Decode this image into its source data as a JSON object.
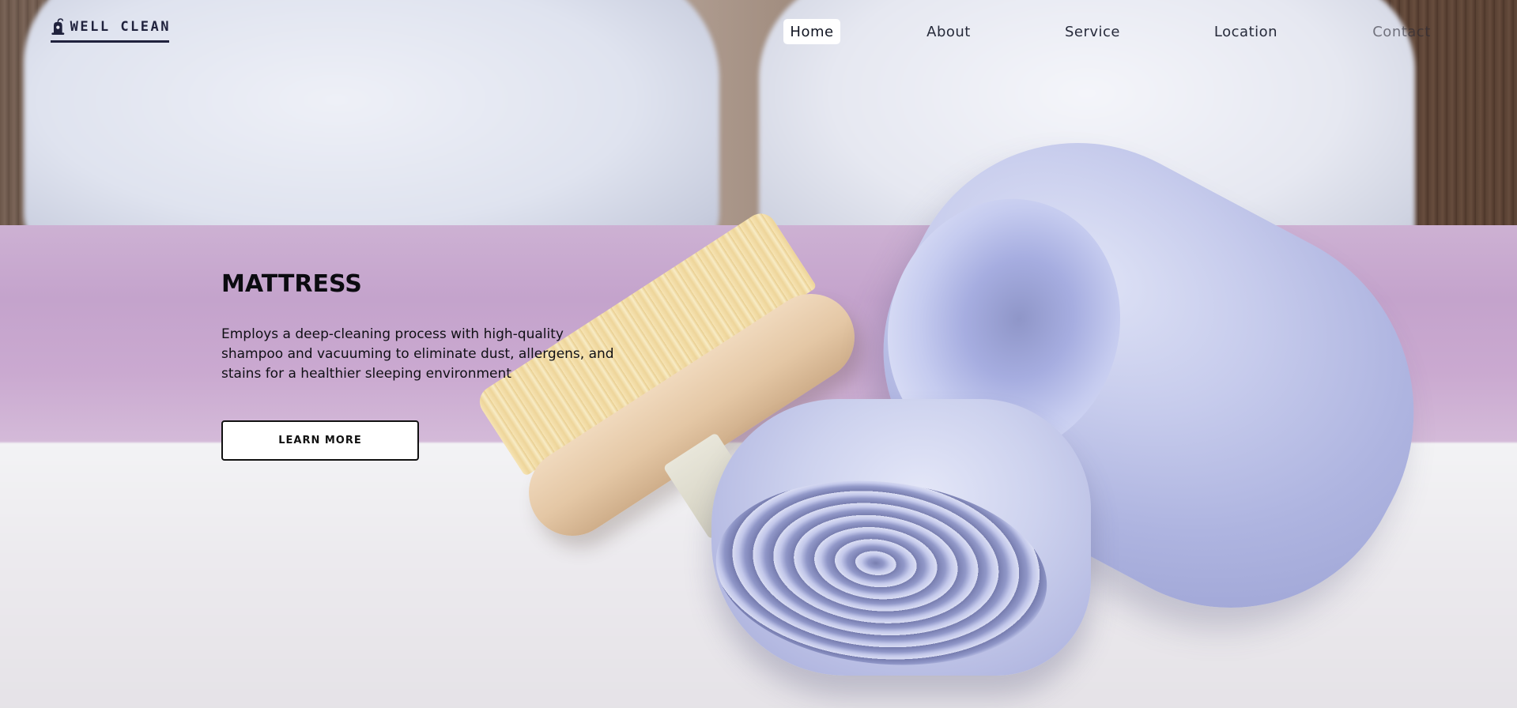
{
  "brand": {
    "name": "WELL CLEAN",
    "logo_icon": "vacuum-cleaner-icon",
    "color": "#20223d"
  },
  "nav": {
    "items": [
      {
        "label": "Home",
        "active": true
      },
      {
        "label": "About",
        "active": false
      },
      {
        "label": "Service",
        "active": false
      },
      {
        "label": "Location",
        "active": false
      },
      {
        "label": "Contact",
        "active": false
      }
    ]
  },
  "hero": {
    "title": "MATTRESS",
    "description": "Employs a deep-cleaning process with high-quality shampoo and vacuuming to eliminate dust, allergens, and stains for a healthier sleeping environment",
    "cta_label": "LEARN MORE",
    "background": "photo-towels-brush-on-bed"
  }
}
